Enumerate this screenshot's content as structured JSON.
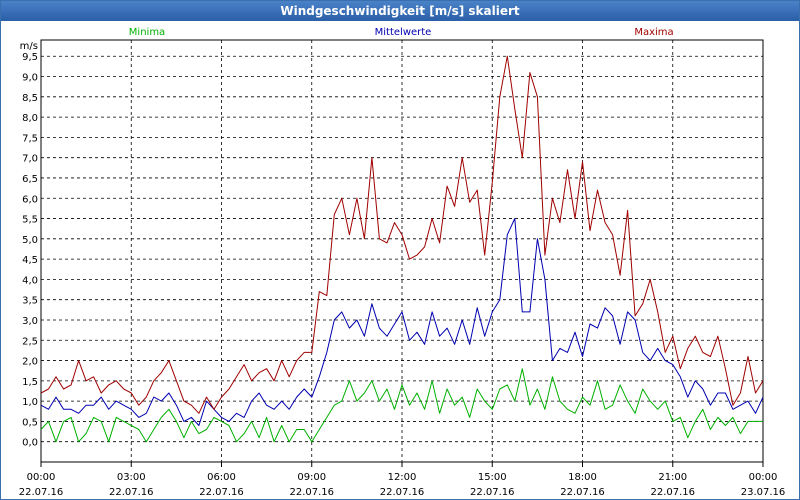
{
  "window": {
    "title": "Windgeschwindigkeit [m/s] skaliert"
  },
  "chart_data": {
    "type": "line",
    "title": "Windgeschwindigkeit [m/s] skaliert",
    "ylabel": "m/s",
    "ylim": [
      -0.5,
      9.9
    ],
    "grid": true,
    "legend_position": "top",
    "yticks": [
      "0,0",
      "0,5",
      "1,0",
      "1,5",
      "2,0",
      "2,5",
      "3,0",
      "3,5",
      "4,0",
      "4,5",
      "5,0",
      "5,5",
      "6,0",
      "6,5",
      "7,0",
      "7,5",
      "8,0",
      "8,5",
      "9,0",
      "9,5"
    ],
    "ytick_values": [
      0,
      0.5,
      1,
      1.5,
      2,
      2.5,
      3,
      3.5,
      4,
      4.5,
      5,
      5.5,
      6,
      6.5,
      7,
      7.5,
      8,
      8.5,
      9,
      9.5
    ],
    "xticks": [
      {
        "time": "00:00",
        "date": "22.07.16",
        "hour": 0
      },
      {
        "time": "03:00",
        "date": "22.07.16",
        "hour": 3
      },
      {
        "time": "06:00",
        "date": "22.07.16",
        "hour": 6
      },
      {
        "time": "09:00",
        "date": "22.07.16",
        "hour": 9
      },
      {
        "time": "12:00",
        "date": "22.07.16",
        "hour": 12
      },
      {
        "time": "15:00",
        "date": "22.07.16",
        "hour": 15
      },
      {
        "time": "18:00",
        "date": "22.07.16",
        "hour": 18
      },
      {
        "time": "21:00",
        "date": "22.07.16",
        "hour": 21
      },
      {
        "time": "00:00",
        "date": "23.07.16",
        "hour": 24
      }
    ],
    "series": [
      {
        "name": "Minima",
        "color": "#00b000",
        "x": [
          0,
          0.25,
          0.5,
          0.75,
          1,
          1.25,
          1.5,
          1.75,
          2,
          2.25,
          2.5,
          2.75,
          3,
          3.25,
          3.5,
          3.75,
          4,
          4.25,
          4.5,
          4.75,
          5,
          5.25,
          5.5,
          5.75,
          6,
          6.25,
          6.5,
          6.75,
          7,
          7.25,
          7.5,
          7.75,
          8,
          8.25,
          8.5,
          8.75,
          9,
          9.25,
          9.5,
          9.75,
          10,
          10.25,
          10.5,
          10.75,
          11,
          11.25,
          11.5,
          11.75,
          12,
          12.25,
          12.5,
          12.75,
          13,
          13.25,
          13.5,
          13.75,
          14,
          14.25,
          14.5,
          14.75,
          15,
          15.25,
          15.5,
          15.75,
          16,
          16.25,
          16.5,
          16.75,
          17,
          17.25,
          17.5,
          17.75,
          18,
          18.25,
          18.5,
          18.75,
          19,
          19.25,
          19.5,
          19.75,
          20,
          20.25,
          20.5,
          20.75,
          21,
          21.25,
          21.5,
          21.75,
          22,
          22.25,
          22.5,
          22.75,
          23,
          23.25,
          23.5,
          23.75,
          24
        ],
        "values": [
          0.3,
          0.5,
          0,
          0.5,
          0.6,
          0,
          0.2,
          0.6,
          0.5,
          0,
          0.6,
          0.5,
          0.4,
          0.3,
          0,
          0.3,
          0.6,
          0.8,
          0.5,
          0.1,
          0.5,
          0.2,
          0.3,
          0.6,
          0.5,
          0.4,
          0,
          0.2,
          0.5,
          0.1,
          0.6,
          0,
          0.4,
          0,
          0.3,
          0.3,
          0,
          0.3,
          0.6,
          0.9,
          1.0,
          1.5,
          1.0,
          1.2,
          1.5,
          1.0,
          1.3,
          0.8,
          1.4,
          0.9,
          1.2,
          0.8,
          1.5,
          0.7,
          1.3,
          0.9,
          1.1,
          0.6,
          1.3,
          1.0,
          0.8,
          1.3,
          1.4,
          1.0,
          1.8,
          0.9,
          1.3,
          0.8,
          1.6,
          1.0,
          0.8,
          0.7,
          1.1,
          0.9,
          1.5,
          0.8,
          0.9,
          1.4,
          1.0,
          0.7,
          1.3,
          1.0,
          0.8,
          1.0,
          0.5,
          0.6,
          0.1,
          0.5,
          0.8,
          0.3,
          0.6,
          0.4,
          0.6,
          0.2,
          0.5,
          0.5,
          0.5
        ]
      },
      {
        "name": "Mittelwerte",
        "color": "#0000b0",
        "x": [
          0,
          0.25,
          0.5,
          0.75,
          1,
          1.25,
          1.5,
          1.75,
          2,
          2.25,
          2.5,
          2.75,
          3,
          3.25,
          3.5,
          3.75,
          4,
          4.25,
          4.5,
          4.75,
          5,
          5.25,
          5.5,
          5.75,
          6,
          6.25,
          6.5,
          6.75,
          7,
          7.25,
          7.5,
          7.75,
          8,
          8.25,
          8.5,
          8.75,
          9,
          9.25,
          9.5,
          9.75,
          10,
          10.25,
          10.5,
          10.75,
          11,
          11.25,
          11.5,
          11.75,
          12,
          12.25,
          12.5,
          12.75,
          13,
          13.25,
          13.5,
          13.75,
          14,
          14.25,
          14.5,
          14.75,
          15,
          15.25,
          15.5,
          15.75,
          16,
          16.25,
          16.5,
          16.75,
          17,
          17.25,
          17.5,
          17.75,
          18,
          18.25,
          18.5,
          18.75,
          19,
          19.25,
          19.5,
          19.75,
          20,
          20.25,
          20.5,
          20.75,
          21,
          21.25,
          21.5,
          21.75,
          22,
          22.25,
          22.5,
          22.75,
          23,
          23.25,
          23.5,
          23.75,
          24
        ],
        "values": [
          0.9,
          0.8,
          1.1,
          0.8,
          0.8,
          0.7,
          0.9,
          0.9,
          1.1,
          0.8,
          1.0,
          0.9,
          0.8,
          0.6,
          0.7,
          1.1,
          1.0,
          1.2,
          0.9,
          0.5,
          0.6,
          0.4,
          1.0,
          0.8,
          0.6,
          0.5,
          0.7,
          0.6,
          1.0,
          1.2,
          0.9,
          0.8,
          1.0,
          0.8,
          1.1,
          1.3,
          1.1,
          1.6,
          2.2,
          3.0,
          3.2,
          2.8,
          3.0,
          2.6,
          3.4,
          2.8,
          2.6,
          2.9,
          3.2,
          2.5,
          2.7,
          2.4,
          3.2,
          2.6,
          2.8,
          2.4,
          3.0,
          2.4,
          3.3,
          2.6,
          3.2,
          3.5,
          5.1,
          5.5,
          3.2,
          3.2,
          5.0,
          4.0,
          2.0,
          2.3,
          2.2,
          2.7,
          2.1,
          2.9,
          2.8,
          3.3,
          3.1,
          2.4,
          3.2,
          3.0,
          2.2,
          2.0,
          2.3,
          2.0,
          1.9,
          1.6,
          1.1,
          1.5,
          1.3,
          0.9,
          1.2,
          1.2,
          0.8,
          0.9,
          1.0,
          0.7,
          1.1
        ]
      },
      {
        "name": "Maxima",
        "color": "#a00000",
        "x": [
          0,
          0.25,
          0.5,
          0.75,
          1,
          1.25,
          1.5,
          1.75,
          2,
          2.25,
          2.5,
          2.75,
          3,
          3.25,
          3.5,
          3.75,
          4,
          4.25,
          4.5,
          4.75,
          5,
          5.25,
          5.5,
          5.75,
          6,
          6.25,
          6.5,
          6.75,
          7,
          7.25,
          7.5,
          7.75,
          8,
          8.25,
          8.5,
          8.75,
          9,
          9.25,
          9.5,
          9.75,
          10,
          10.25,
          10.5,
          10.75,
          11,
          11.25,
          11.5,
          11.75,
          12,
          12.25,
          12.5,
          12.75,
          13,
          13.25,
          13.5,
          13.75,
          14,
          14.25,
          14.5,
          14.75,
          15,
          15.25,
          15.5,
          15.75,
          16,
          16.25,
          16.5,
          16.75,
          17,
          17.25,
          17.5,
          17.75,
          18,
          18.25,
          18.5,
          18.75,
          19,
          19.25,
          19.5,
          19.75,
          20,
          20.25,
          20.5,
          20.75,
          21,
          21.25,
          21.5,
          21.75,
          22,
          22.25,
          22.5,
          22.75,
          23,
          23.25,
          23.5,
          23.75,
          24
        ],
        "values": [
          1.2,
          1.3,
          1.6,
          1.3,
          1.4,
          2.0,
          1.5,
          1.6,
          1.2,
          1.4,
          1.5,
          1.3,
          1.2,
          0.9,
          1.1,
          1.5,
          1.7,
          2.0,
          1.5,
          1.0,
          0.9,
          0.7,
          1.1,
          0.8,
          1.1,
          1.3,
          1.6,
          1.9,
          1.5,
          1.7,
          1.8,
          1.5,
          2.0,
          1.6,
          2.0,
          2.2,
          2.2,
          3.7,
          3.6,
          5.6,
          6.0,
          5.1,
          6.0,
          5.0,
          7.0,
          5.0,
          4.9,
          5.4,
          5.1,
          4.5,
          4.6,
          4.8,
          5.5,
          4.9,
          6.3,
          5.8,
          7.0,
          5.9,
          6.2,
          4.6,
          6.4,
          8.5,
          9.5,
          8.2,
          7.0,
          9.1,
          8.5,
          4.6,
          6.0,
          5.4,
          6.7,
          5.5,
          6.9,
          5.2,
          6.2,
          5.4,
          5.1,
          4.1,
          5.7,
          3.1,
          3.4,
          4.0,
          3.2,
          2.2,
          2.6,
          1.8,
          2.3,
          2.6,
          2.2,
          2.1,
          2.6,
          1.8,
          0.9,
          1.2,
          2.1,
          1.2,
          1.5
        ]
      }
    ]
  }
}
